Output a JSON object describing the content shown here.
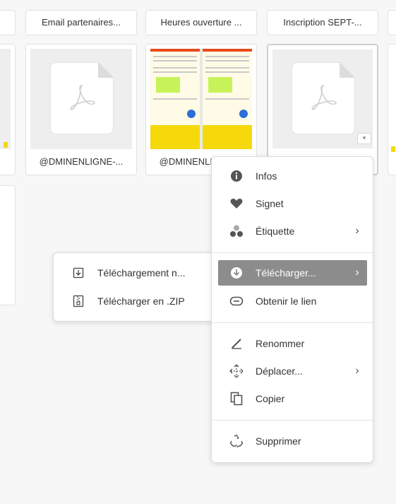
{
  "row1": {
    "captions": [
      "Email partenaires...",
      "Heures ouverture ...",
      "Inscription SEPT-..."
    ]
  },
  "row2": {
    "tiles": [
      {
        "caption": "@DMINENLIGNE-...",
        "kind": "pdf"
      },
      {
        "caption": "@DMINENLIGNE-...",
        "kind": "poster"
      },
      {
        "caption": "",
        "kind": "pdf"
      }
    ]
  },
  "context_menu": {
    "items": [
      {
        "label": "Infos",
        "icon": "info-icon"
      },
      {
        "label": "Signet",
        "icon": "heart-icon"
      },
      {
        "label": "Étiquette",
        "icon": "tags-icon",
        "submenu": true
      },
      {
        "label": "Télécharger...",
        "icon": "download-icon",
        "submenu": true,
        "active": true
      },
      {
        "label": "Obtenir le lien",
        "icon": "link-icon"
      },
      {
        "label": "Renommer",
        "icon": "pencil-icon"
      },
      {
        "label": "Déplacer...",
        "icon": "move-icon",
        "submenu": true
      },
      {
        "label": "Copier",
        "icon": "copy-icon"
      },
      {
        "label": "Supprimer",
        "icon": "recycle-icon"
      }
    ],
    "chevron": "›"
  },
  "download_submenu": {
    "items": [
      {
        "label": "Téléchargement n...",
        "icon": "download-box-icon"
      },
      {
        "label": "Télécharger en .ZIP",
        "icon": "zip-icon"
      }
    ]
  },
  "colors": {
    "active_item_bg": "#8c8c8c",
    "accent_yellow": "#f5d90a"
  }
}
